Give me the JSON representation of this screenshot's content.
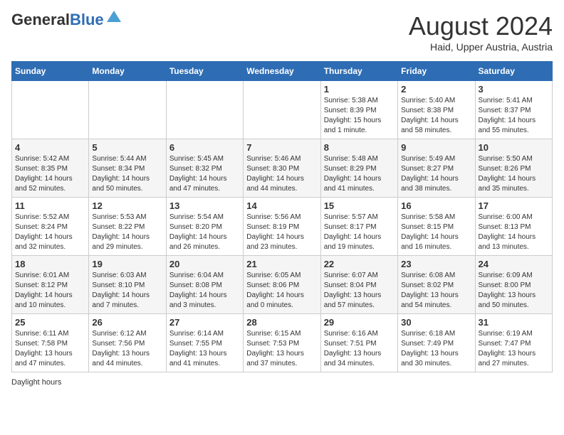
{
  "logo": {
    "general": "General",
    "blue": "Blue"
  },
  "title": "August 2024",
  "location": "Haid, Upper Austria, Austria",
  "days_of_week": [
    "Sunday",
    "Monday",
    "Tuesday",
    "Wednesday",
    "Thursday",
    "Friday",
    "Saturday"
  ],
  "footer": "Daylight hours",
  "weeks": [
    [
      {
        "day": "",
        "info": ""
      },
      {
        "day": "",
        "info": ""
      },
      {
        "day": "",
        "info": ""
      },
      {
        "day": "",
        "info": ""
      },
      {
        "day": "1",
        "info": "Sunrise: 5:38 AM\nSunset: 8:39 PM\nDaylight: 15 hours\nand 1 minute."
      },
      {
        "day": "2",
        "info": "Sunrise: 5:40 AM\nSunset: 8:38 PM\nDaylight: 14 hours\nand 58 minutes."
      },
      {
        "day": "3",
        "info": "Sunrise: 5:41 AM\nSunset: 8:37 PM\nDaylight: 14 hours\nand 55 minutes."
      }
    ],
    [
      {
        "day": "4",
        "info": "Sunrise: 5:42 AM\nSunset: 8:35 PM\nDaylight: 14 hours\nand 52 minutes."
      },
      {
        "day": "5",
        "info": "Sunrise: 5:44 AM\nSunset: 8:34 PM\nDaylight: 14 hours\nand 50 minutes."
      },
      {
        "day": "6",
        "info": "Sunrise: 5:45 AM\nSunset: 8:32 PM\nDaylight: 14 hours\nand 47 minutes."
      },
      {
        "day": "7",
        "info": "Sunrise: 5:46 AM\nSunset: 8:30 PM\nDaylight: 14 hours\nand 44 minutes."
      },
      {
        "day": "8",
        "info": "Sunrise: 5:48 AM\nSunset: 8:29 PM\nDaylight: 14 hours\nand 41 minutes."
      },
      {
        "day": "9",
        "info": "Sunrise: 5:49 AM\nSunset: 8:27 PM\nDaylight: 14 hours\nand 38 minutes."
      },
      {
        "day": "10",
        "info": "Sunrise: 5:50 AM\nSunset: 8:26 PM\nDaylight: 14 hours\nand 35 minutes."
      }
    ],
    [
      {
        "day": "11",
        "info": "Sunrise: 5:52 AM\nSunset: 8:24 PM\nDaylight: 14 hours\nand 32 minutes."
      },
      {
        "day": "12",
        "info": "Sunrise: 5:53 AM\nSunset: 8:22 PM\nDaylight: 14 hours\nand 29 minutes."
      },
      {
        "day": "13",
        "info": "Sunrise: 5:54 AM\nSunset: 8:20 PM\nDaylight: 14 hours\nand 26 minutes."
      },
      {
        "day": "14",
        "info": "Sunrise: 5:56 AM\nSunset: 8:19 PM\nDaylight: 14 hours\nand 23 minutes."
      },
      {
        "day": "15",
        "info": "Sunrise: 5:57 AM\nSunset: 8:17 PM\nDaylight: 14 hours\nand 19 minutes."
      },
      {
        "day": "16",
        "info": "Sunrise: 5:58 AM\nSunset: 8:15 PM\nDaylight: 14 hours\nand 16 minutes."
      },
      {
        "day": "17",
        "info": "Sunrise: 6:00 AM\nSunset: 8:13 PM\nDaylight: 14 hours\nand 13 minutes."
      }
    ],
    [
      {
        "day": "18",
        "info": "Sunrise: 6:01 AM\nSunset: 8:12 PM\nDaylight: 14 hours\nand 10 minutes."
      },
      {
        "day": "19",
        "info": "Sunrise: 6:03 AM\nSunset: 8:10 PM\nDaylight: 14 hours\nand 7 minutes."
      },
      {
        "day": "20",
        "info": "Sunrise: 6:04 AM\nSunset: 8:08 PM\nDaylight: 14 hours\nand 3 minutes."
      },
      {
        "day": "21",
        "info": "Sunrise: 6:05 AM\nSunset: 8:06 PM\nDaylight: 14 hours\nand 0 minutes."
      },
      {
        "day": "22",
        "info": "Sunrise: 6:07 AM\nSunset: 8:04 PM\nDaylight: 13 hours\nand 57 minutes."
      },
      {
        "day": "23",
        "info": "Sunrise: 6:08 AM\nSunset: 8:02 PM\nDaylight: 13 hours\nand 54 minutes."
      },
      {
        "day": "24",
        "info": "Sunrise: 6:09 AM\nSunset: 8:00 PM\nDaylight: 13 hours\nand 50 minutes."
      }
    ],
    [
      {
        "day": "25",
        "info": "Sunrise: 6:11 AM\nSunset: 7:58 PM\nDaylight: 13 hours\nand 47 minutes."
      },
      {
        "day": "26",
        "info": "Sunrise: 6:12 AM\nSunset: 7:56 PM\nDaylight: 13 hours\nand 44 minutes."
      },
      {
        "day": "27",
        "info": "Sunrise: 6:14 AM\nSunset: 7:55 PM\nDaylight: 13 hours\nand 41 minutes."
      },
      {
        "day": "28",
        "info": "Sunrise: 6:15 AM\nSunset: 7:53 PM\nDaylight: 13 hours\nand 37 minutes."
      },
      {
        "day": "29",
        "info": "Sunrise: 6:16 AM\nSunset: 7:51 PM\nDaylight: 13 hours\nand 34 minutes."
      },
      {
        "day": "30",
        "info": "Sunrise: 6:18 AM\nSunset: 7:49 PM\nDaylight: 13 hours\nand 30 minutes."
      },
      {
        "day": "31",
        "info": "Sunrise: 6:19 AM\nSunset: 7:47 PM\nDaylight: 13 hours\nand 27 minutes."
      }
    ]
  ]
}
